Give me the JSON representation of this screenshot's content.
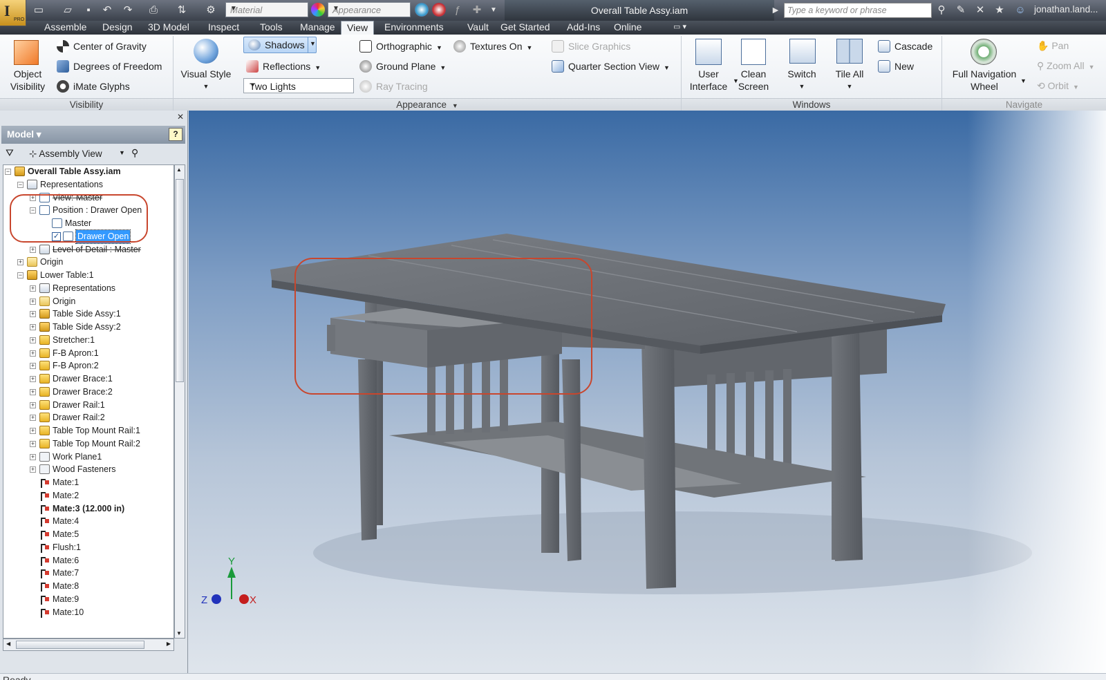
{
  "qat": {
    "material_placeholder": "Material",
    "appearance_placeholder": "Appearance"
  },
  "window": {
    "title": "Overall Table Assy.iam"
  },
  "search": {
    "placeholder": "Type a keyword or phrase"
  },
  "user": {
    "name": "jonathan.land..."
  },
  "tabs": [
    {
      "label": "Assemble"
    },
    {
      "label": "Design"
    },
    {
      "label": "3D Model"
    },
    {
      "label": "Inspect"
    },
    {
      "label": "Tools"
    },
    {
      "label": "Manage"
    },
    {
      "label": "View"
    },
    {
      "label": "Environments"
    },
    {
      "label": "Vault"
    },
    {
      "label": "Get Started"
    },
    {
      "label": "Add-Ins"
    },
    {
      "label": "Online"
    }
  ],
  "active_tab": "View",
  "ribbon": {
    "visibility": {
      "label": "Visibility",
      "object_visibility_1": "Object",
      "object_visibility_2": "Visibility",
      "center_of_gravity": "Center of Gravity",
      "degrees_of_freedom": "Degrees of Freedom",
      "imate_glyphs": "iMate Glyphs"
    },
    "appearance": {
      "label": "Appearance",
      "visual_style": "Visual Style",
      "shadows": "Shadows",
      "reflections": "Reflections",
      "lights": "Two Lights",
      "orthographic": "Orthographic",
      "ground_plane": "Ground Plane",
      "ray_tracing": "Ray Tracing",
      "textures_on": "Textures On",
      "slice_graphics": "Slice Graphics",
      "quarter_section_view": "Quarter Section View"
    },
    "windows": {
      "label": "Windows",
      "user_interface_1": "User",
      "user_interface_2": "Interface",
      "clean_screen_1": "Clean",
      "clean_screen_2": "Screen",
      "switch": "Switch",
      "tile_all": "Tile All",
      "cascade": "Cascade",
      "new": "New"
    },
    "navigate": {
      "label": "Navigate",
      "full_nav_1": "Full Navigation",
      "full_nav_2": "Wheel",
      "pan": "Pan",
      "zoom_all": "Zoom All",
      "orbit": "Orbit"
    }
  },
  "browser": {
    "title": "Model",
    "view_mode": "Assembly View",
    "tree": [
      {
        "label": "Overall Table Assy.iam",
        "bold": true,
        "icon": "asm"
      },
      {
        "label": "Representations",
        "icon": "rep"
      },
      {
        "label": "View: Master",
        "icon": "pos"
      },
      {
        "label": "Position : Drawer Open",
        "icon": "pos"
      },
      {
        "label": "Master",
        "icon": "pos"
      },
      {
        "label": "Drawer Open",
        "icon": "pos",
        "selected": true
      },
      {
        "label": "Level of Detail : Master",
        "icon": "rep"
      },
      {
        "label": "Origin",
        "icon": "folder"
      },
      {
        "label": "Lower Table:1",
        "icon": "asm"
      },
      {
        "label": "Representations",
        "icon": "rep"
      },
      {
        "label": "Origin",
        "icon": "folder"
      },
      {
        "label": "Table Side Assy:1",
        "icon": "asm"
      },
      {
        "label": "Table Side Assy:2",
        "icon": "asm"
      },
      {
        "label": "Stretcher:1",
        "icon": "part"
      },
      {
        "label": "F-B Apron:1",
        "icon": "part"
      },
      {
        "label": "F-B Apron:2",
        "icon": "part"
      },
      {
        "label": "Drawer Brace:1",
        "icon": "part"
      },
      {
        "label": "Drawer Brace:2",
        "icon": "part"
      },
      {
        "label": "Drawer Rail:1",
        "icon": "part"
      },
      {
        "label": "Drawer Rail:2",
        "icon": "part"
      },
      {
        "label": "Table Top Mount Rail:1",
        "icon": "part"
      },
      {
        "label": "Table Top Mount Rail:2",
        "icon": "part"
      },
      {
        "label": "Work Plane1",
        "icon": "wp"
      },
      {
        "label": "Wood Fasteners",
        "icon": "wp"
      },
      {
        "label": "Mate:1",
        "icon": "mate"
      },
      {
        "label": "Mate:2",
        "icon": "mate"
      },
      {
        "label": "Mate:3 (12.000 in)",
        "icon": "mate",
        "bold": true
      },
      {
        "label": "Mate:4",
        "icon": "mate"
      },
      {
        "label": "Mate:5",
        "icon": "mate"
      },
      {
        "label": "Flush:1",
        "icon": "mate"
      },
      {
        "label": "Mate:6",
        "icon": "mate"
      },
      {
        "label": "Mate:7",
        "icon": "mate"
      },
      {
        "label": "Mate:8",
        "icon": "mate"
      },
      {
        "label": "Mate:9",
        "icon": "mate"
      },
      {
        "label": "Mate:10",
        "icon": "mate"
      }
    ]
  },
  "axes": {
    "x": "X",
    "y": "Y",
    "z": "Z"
  },
  "status": {
    "text": "Ready"
  },
  "colors": {
    "highlight": "#c8462d",
    "selection": "#3399ff",
    "model": "#6b6f74"
  }
}
